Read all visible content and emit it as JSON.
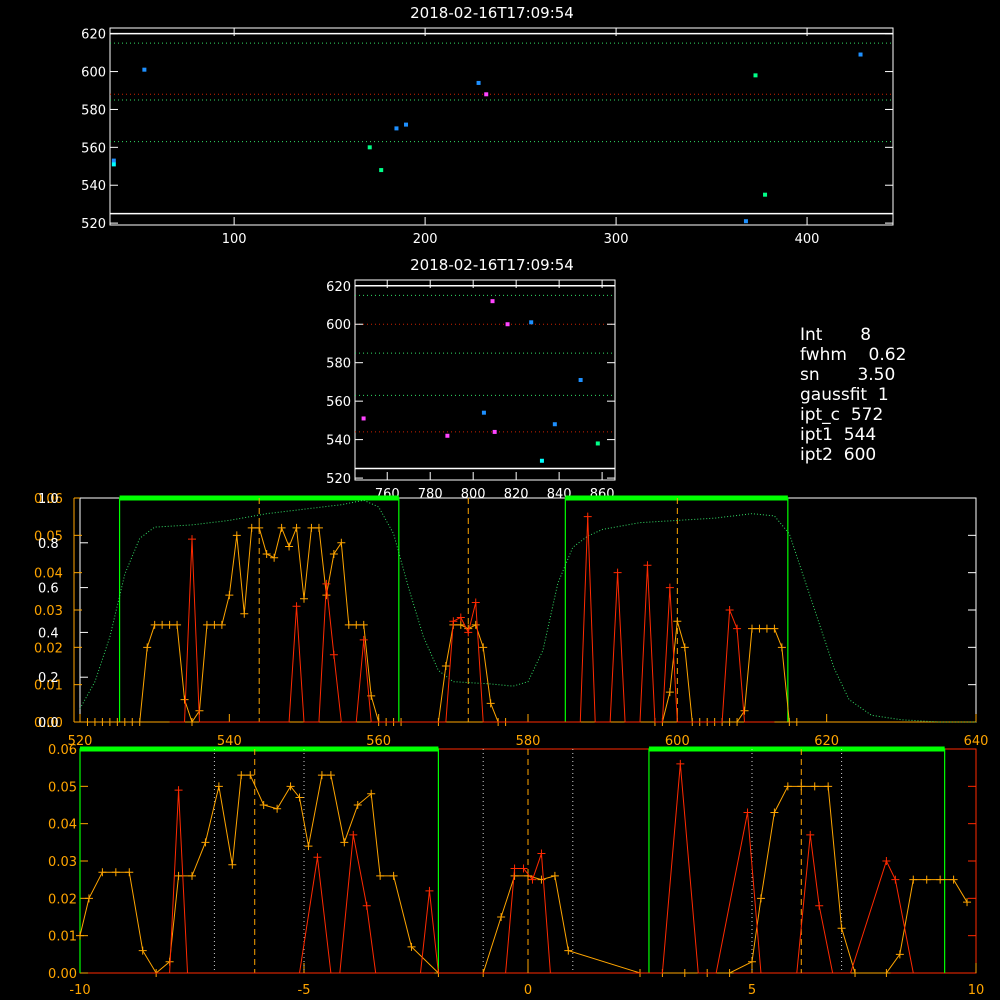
{
  "colors": {
    "background": "#000000",
    "axis": "#ffffff",
    "green": "#00ff00",
    "orange": "#ffa500",
    "red": "#ff2a00",
    "blue": "#1e90ff",
    "cyan": "#00ffff",
    "magenta": "#ff44ff",
    "spring": "#00ff88",
    "dotted_green": "#33dd66",
    "dotted_red": "#cc2200",
    "dotted_white": "#cccccc"
  },
  "info": {
    "lines": [
      "Int       8",
      "fwhm    0.62",
      "sn       3.50",
      "gaussfit  1",
      "ipt_c  572",
      "ipt1  544",
      "ipt2  600"
    ]
  },
  "chart_data": [
    {
      "type": "scatter",
      "title": "2018-02-16T17:09:54",
      "xlim": [
        35,
        445
      ],
      "ylim": [
        519,
        623
      ],
      "xticks": [
        100,
        200,
        300,
        400
      ],
      "yticks": [
        520,
        540,
        560,
        580,
        600,
        620
      ],
      "hlines": [
        {
          "y": 620,
          "style": "solid",
          "color": "axis"
        },
        {
          "y": 615,
          "style": "dotted",
          "color": "dotted_green"
        },
        {
          "y": 588,
          "style": "dotted",
          "color": "dotted_red"
        },
        {
          "y": 585,
          "style": "dotted",
          "color": "dotted_green"
        },
        {
          "y": 563,
          "style": "dotted",
          "color": "dotted_green"
        },
        {
          "y": 525,
          "style": "solid",
          "color": "axis"
        }
      ],
      "points": [
        {
          "x": 37,
          "y": 553,
          "color": "blue"
        },
        {
          "x": 37,
          "y": 551,
          "color": "cyan"
        },
        {
          "x": 53,
          "y": 601,
          "color": "blue"
        },
        {
          "x": 171,
          "y": 560,
          "color": "spring"
        },
        {
          "x": 177,
          "y": 548,
          "color": "spring"
        },
        {
          "x": 185,
          "y": 570,
          "color": "blue"
        },
        {
          "x": 190,
          "y": 572,
          "color": "blue"
        },
        {
          "x": 228,
          "y": 594,
          "color": "blue"
        },
        {
          "x": 232,
          "y": 588,
          "color": "magenta"
        },
        {
          "x": 368,
          "y": 521,
          "color": "blue"
        },
        {
          "x": 373,
          "y": 598,
          "color": "spring"
        },
        {
          "x": 378,
          "y": 535,
          "color": "spring"
        },
        {
          "x": 428,
          "y": 609,
          "color": "blue"
        }
      ]
    },
    {
      "type": "scatter",
      "title": "2018-02-16T17:09:54",
      "xlim": [
        745,
        866
      ],
      "ylim": [
        519,
        623
      ],
      "xticks": [
        760,
        780,
        800,
        820,
        840,
        860
      ],
      "yticks": [
        520,
        540,
        560,
        580,
        600,
        620
      ],
      "hlines": [
        {
          "y": 620,
          "style": "solid",
          "color": "axis"
        },
        {
          "y": 615,
          "style": "dotted",
          "color": "dotted_green"
        },
        {
          "y": 600,
          "style": "dotted",
          "color": "dotted_red"
        },
        {
          "y": 585,
          "style": "dotted",
          "color": "dotted_green"
        },
        {
          "y": 563,
          "style": "dotted",
          "color": "dotted_green"
        },
        {
          "y": 544,
          "style": "dotted",
          "color": "dotted_red"
        },
        {
          "y": 525,
          "style": "solid",
          "color": "axis"
        }
      ],
      "points": [
        {
          "x": 749,
          "y": 551,
          "color": "magenta"
        },
        {
          "x": 788,
          "y": 542,
          "color": "magenta"
        },
        {
          "x": 805,
          "y": 554,
          "color": "blue"
        },
        {
          "x": 809,
          "y": 612,
          "color": "magenta"
        },
        {
          "x": 810,
          "y": 544,
          "color": "magenta"
        },
        {
          "x": 816,
          "y": 600,
          "color": "magenta"
        },
        {
          "x": 827,
          "y": 601,
          "color": "blue"
        },
        {
          "x": 832,
          "y": 529,
          "color": "cyan"
        },
        {
          "x": 838,
          "y": 548,
          "color": "blue"
        },
        {
          "x": 850,
          "y": 571,
          "color": "blue"
        },
        {
          "x": 858,
          "y": 538,
          "color": "spring"
        }
      ]
    },
    {
      "type": "line",
      "xlim": [
        520,
        640
      ],
      "xticks": [
        520,
        540,
        560,
        580,
        600,
        620,
        640
      ],
      "left_axis_white": {
        "ylim": [
          0,
          1.0
        ],
        "ticks": [
          0.0,
          0.2,
          0.4,
          0.6,
          0.8,
          1.0
        ],
        "labels": [
          "0.0",
          "0.2",
          "0.4",
          "0.6",
          "0.8",
          "1.0"
        ]
      },
      "left_axis_orange": {
        "ylim": [
          0,
          0.06
        ],
        "ticks": [
          0.0,
          0.01,
          0.02,
          0.03,
          0.04,
          0.05,
          0.06
        ],
        "labels": [
          "0.00",
          "0.01",
          "0.02",
          "0.03",
          "0.04",
          "0.05",
          "0.06"
        ]
      },
      "green_windows": [
        [
          525.3,
          562.7
        ],
        [
          585.0,
          614.8
        ]
      ],
      "vlines": [
        544,
        572,
        600
      ],
      "transmission_x": [
        520,
        522,
        524,
        526,
        528,
        530,
        535,
        540,
        545,
        550,
        555,
        558,
        560,
        562,
        564,
        566,
        568,
        570,
        575,
        578,
        580,
        582,
        584,
        586,
        588,
        590,
        595,
        600,
        605,
        610,
        613,
        615,
        617,
        619,
        621,
        623,
        626,
        630,
        635,
        640
      ],
      "transmission_y": [
        0.06,
        0.18,
        0.38,
        0.66,
        0.82,
        0.87,
        0.88,
        0.9,
        0.93,
        0.95,
        0.97,
        0.99,
        0.96,
        0.84,
        0.6,
        0.38,
        0.23,
        0.18,
        0.17,
        0.16,
        0.18,
        0.32,
        0.62,
        0.78,
        0.83,
        0.86,
        0.89,
        0.9,
        0.91,
        0.93,
        0.92,
        0.84,
        0.64,
        0.44,
        0.24,
        0.1,
        0.03,
        0.01,
        0.0,
        0.0
      ],
      "orange_x": [
        521,
        522,
        523,
        524,
        525,
        526,
        527,
        528,
        529,
        530,
        531,
        532,
        533,
        534,
        535,
        536,
        537,
        538,
        539,
        540,
        541,
        542,
        543,
        544,
        545,
        546,
        547,
        548,
        549,
        550,
        551,
        552,
        553,
        554,
        555,
        556,
        557,
        558,
        559,
        560,
        561,
        562,
        563,
        568,
        569,
        570,
        571,
        572,
        573,
        574,
        575,
        576,
        577,
        597,
        598,
        599,
        600,
        601,
        602,
        603,
        604,
        605,
        606,
        607,
        608,
        609,
        610,
        611,
        612,
        613,
        614,
        615,
        616
      ],
      "orange_y": [
        0.0,
        0.0,
        0.0,
        0.0,
        0.0,
        0.0,
        0.0,
        0.0,
        0.02,
        0.026,
        0.026,
        0.026,
        0.026,
        0.006,
        0.0,
        0.003,
        0.026,
        0.026,
        0.026,
        0.034,
        0.05,
        0.029,
        0.052,
        0.052,
        0.045,
        0.044,
        0.052,
        0.047,
        0.052,
        0.033,
        0.052,
        0.052,
        0.034,
        0.045,
        0.048,
        0.026,
        0.026,
        0.026,
        0.007,
        0.0,
        0.0,
        0.0,
        0.0,
        0.0,
        0.015,
        0.026,
        0.026,
        0.025,
        0.026,
        0.02,
        0.005,
        0.0,
        0.0,
        0.0,
        0.0,
        0.008,
        0.027,
        0.02,
        0.0,
        0.0,
        0.0,
        0.0,
        0.0,
        0.0,
        0.0,
        0.003,
        0.025,
        0.025,
        0.025,
        0.025,
        0.02,
        0.0,
        0.0
      ],
      "red_x": [
        532,
        533,
        534,
        535,
        536,
        537,
        538,
        547,
        548,
        549,
        550,
        551,
        552,
        553,
        554,
        555,
        556,
        557,
        558,
        559,
        560,
        569,
        570,
        571,
        572,
        573,
        574,
        575,
        576,
        587,
        588,
        589,
        590,
        591,
        592,
        593,
        594,
        595,
        596,
        597,
        598,
        599,
        600,
        601,
        602,
        603,
        604,
        605,
        606,
        607,
        608,
        609,
        610,
        611,
        612,
        613
      ],
      "red_y": [
        0.0,
        0.0,
        0.0,
        0.049,
        0.0,
        0.0,
        0.0,
        0.0,
        0.0,
        0.031,
        0.0,
        0.0,
        0.0,
        0.037,
        0.018,
        0.0,
        0.0,
        0.0,
        0.022,
        0.0,
        0.0,
        0.0,
        0.027,
        0.028,
        0.024,
        0.032,
        0.0,
        0.0,
        0.0,
        0.0,
        0.055,
        0.0,
        0.0,
        0.0,
        0.04,
        0.0,
        0.0,
        0.0,
        0.042,
        0.0,
        0.0,
        0.036,
        0.0,
        0.0,
        0.0,
        0.0,
        0.0,
        0.0,
        0.0,
        0.03,
        0.025,
        0.0,
        0.0,
        0.0,
        0.0,
        0.0
      ]
    },
    {
      "type": "line",
      "xlim": [
        -10,
        10
      ],
      "xticks": [
        -10,
        -5,
        0,
        5,
        10
      ],
      "ylim": [
        0,
        0.06
      ],
      "yticks": [
        0.0,
        0.01,
        0.02,
        0.03,
        0.04,
        0.05,
        0.06
      ],
      "ylabels": [
        "0.00",
        "0.01",
        "0.02",
        "0.03",
        "0.04",
        "0.05",
        "0.06"
      ],
      "right_axis": {
        "ylim": [
          0,
          12
        ],
        "ticks": [
          0,
          2,
          4,
          6,
          8,
          10,
          12
        ]
      },
      "green_windows": [
        [
          -10,
          -2
        ],
        [
          2.7,
          9.3
        ]
      ],
      "dotted_vlines": [
        -7,
        -5,
        -1,
        1,
        5,
        7
      ],
      "dashed_vlines": [
        -6.1,
        0,
        6.1
      ],
      "orange_x": [
        -10,
        -9.8,
        -9.5,
        -9.2,
        -8.9,
        -8.6,
        -8.3,
        -8.0,
        -7.8,
        -7.5,
        -7.2,
        -6.9,
        -6.6,
        -6.4,
        -6.2,
        -5.9,
        -5.6,
        -5.3,
        -5.1,
        -4.9,
        -4.6,
        -4.4,
        -4.1,
        -3.8,
        -3.5,
        -3.3,
        -3.0,
        -2.6,
        -2.0,
        -1.0,
        -0.6,
        -0.3,
        0,
        0.3,
        0.6,
        0.9,
        2.5,
        3.0,
        3.5,
        4.0,
        4.5,
        5.0,
        5.2,
        5.5,
        5.8,
        6.1,
        6.4,
        6.7,
        7.0,
        7.3,
        8.0,
        8.3,
        8.6,
        8.9,
        9.2,
        9.5,
        9.8
      ],
      "orange_y": [
        0.01,
        0.02,
        0.027,
        0.027,
        0.027,
        0.006,
        0.0,
        0.003,
        0.026,
        0.026,
        0.035,
        0.05,
        0.029,
        0.053,
        0.053,
        0.045,
        0.044,
        0.05,
        0.047,
        0.034,
        0.053,
        0.053,
        0.035,
        0.045,
        0.048,
        0.026,
        0.026,
        0.007,
        0.0,
        0.0,
        0.015,
        0.026,
        0.026,
        0.025,
        0.026,
        0.006,
        0.0,
        0.0,
        0.0,
        0.0,
        0.0,
        0.003,
        0.02,
        0.043,
        0.05,
        0.05,
        0.05,
        0.05,
        0.012,
        0.0,
        0.0,
        0.005,
        0.025,
        0.025,
        0.025,
        0.025,
        0.019
      ],
      "red_x": [
        -8.4,
        -8.0,
        -7.8,
        -7.6,
        -7.0,
        -5.1,
        -4.7,
        -4.4,
        -4.2,
        -3.9,
        -3.6,
        -3.4,
        -2.4,
        -2.2,
        -2.0,
        -0.5,
        -0.3,
        -0.1,
        0.1,
        0.3,
        0.5,
        3.0,
        3.4,
        3.8,
        4.2,
        4.9,
        5.2,
        5.6,
        6.0,
        6.3,
        6.5,
        6.8,
        7.2,
        8.0,
        8.2,
        8.6
      ],
      "red_y": [
        0.0,
        0.0,
        0.049,
        0.0,
        0.0,
        0.0,
        0.031,
        0.0,
        0.0,
        0.037,
        0.018,
        0.0,
        0.0,
        0.022,
        0.0,
        0.0,
        0.028,
        0.028,
        0.025,
        0.032,
        0.0,
        0.0,
        0.056,
        0.0,
        0.0,
        0.043,
        0.0,
        0.0,
        0.0,
        0.037,
        0.018,
        0.0,
        0.0,
        0.03,
        0.025,
        0.0
      ]
    }
  ]
}
